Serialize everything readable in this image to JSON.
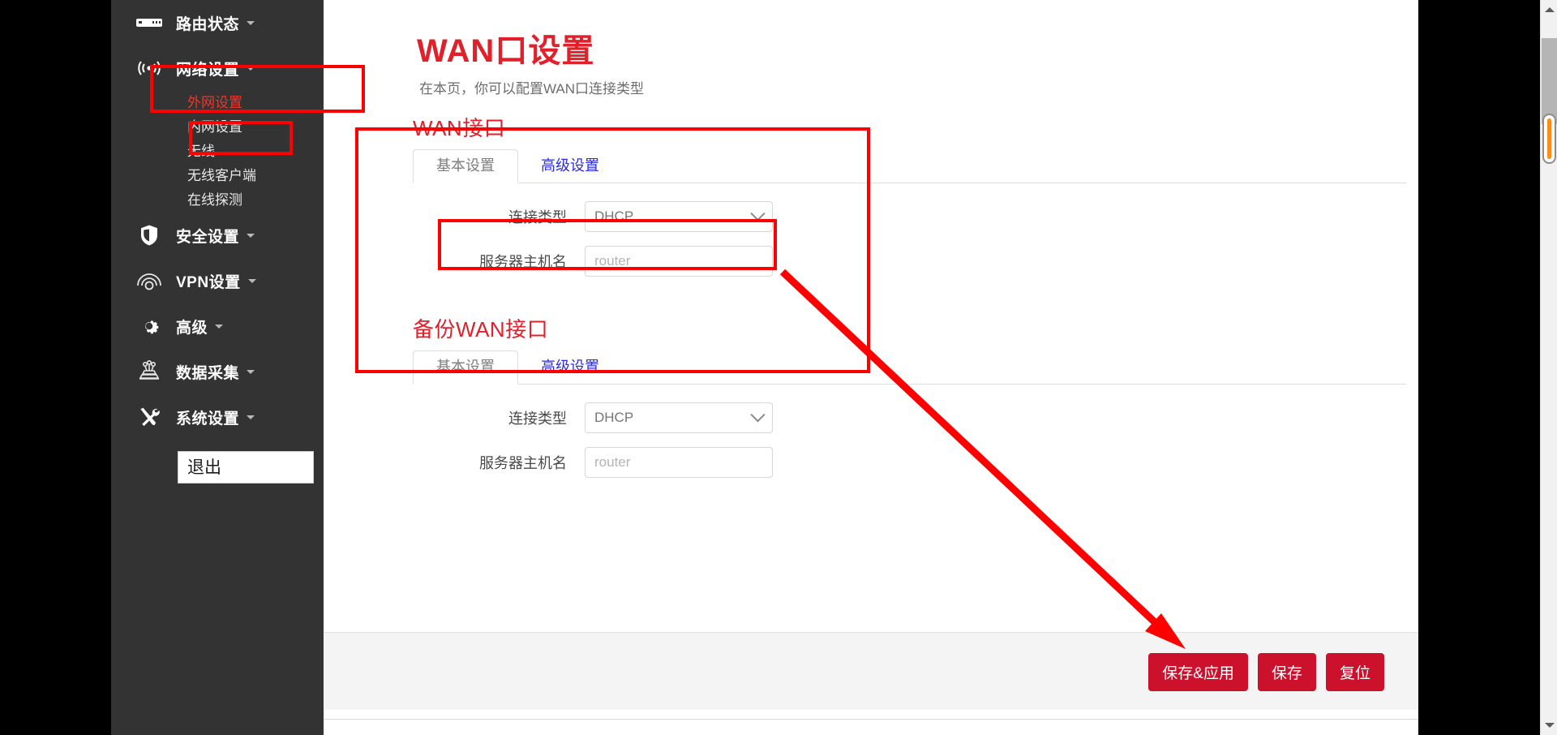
{
  "sidebar": {
    "items": [
      {
        "label": "路由状态",
        "icon": "router-status-icon",
        "caret": true,
        "highlight": false
      },
      {
        "label": "网络设置",
        "icon": "network-signal-icon",
        "caret": true,
        "highlight": true
      },
      {
        "label": "安全设置",
        "icon": "shield-icon",
        "caret": true,
        "highlight": false
      },
      {
        "label": "VPN设置",
        "icon": "vpn-eye-icon",
        "caret": true,
        "highlight": false
      },
      {
        "label": "高级",
        "icon": "gear-icon",
        "caret": true,
        "highlight": false
      },
      {
        "label": "数据采集",
        "icon": "data-collect-icon",
        "caret": true,
        "highlight": false
      },
      {
        "label": "系统设置",
        "icon": "tools-icon",
        "caret": true,
        "highlight": false
      }
    ],
    "network_submenu": [
      {
        "label": "外网设置",
        "active": true
      },
      {
        "label": "内网设置",
        "active": false
      },
      {
        "label": "无线",
        "active": false
      },
      {
        "label": "无线客户端",
        "active": false
      },
      {
        "label": "在线探测",
        "active": false
      }
    ],
    "logout_label": "退出"
  },
  "page": {
    "title": "WAN口设置",
    "subtitle": "在本页，你可以配置WAN口连接类型"
  },
  "wan_section": {
    "title": "WAN接口",
    "tabs": [
      {
        "label": "基本设置",
        "active": true
      },
      {
        "label": "高级设置",
        "active": false
      }
    ],
    "fields": [
      {
        "label": "连接类型",
        "type": "select",
        "value": "DHCP"
      },
      {
        "label": "服务器主机名",
        "type": "input",
        "value": "",
        "placeholder": "router"
      }
    ]
  },
  "backup_wan_section": {
    "title": "备份WAN接口",
    "tabs": [
      {
        "label": "基本设置",
        "active": true
      },
      {
        "label": "高级设置",
        "active": false
      }
    ],
    "fields": [
      {
        "label": "连接类型",
        "type": "select",
        "value": "DHCP"
      },
      {
        "label": "服务器主机名",
        "type": "input",
        "value": "",
        "placeholder": "router"
      }
    ]
  },
  "footer": {
    "buttons": [
      {
        "label": "保存&应用"
      },
      {
        "label": "保存"
      },
      {
        "label": "复位"
      }
    ]
  },
  "colors": {
    "brand_red": "#e0202a",
    "button_red": "#cc112c",
    "annotation_red": "#ff0000",
    "sidebar_bg": "#333333",
    "scrollbar_thumb": "#ff8c19",
    "tab_link_blue": "#2c2ce0"
  },
  "scrollbar": {
    "up_arrow": "triangle-up-icon",
    "down_arrow": "triangle-down-icon"
  },
  "select_options": [
    "DHCP"
  ]
}
